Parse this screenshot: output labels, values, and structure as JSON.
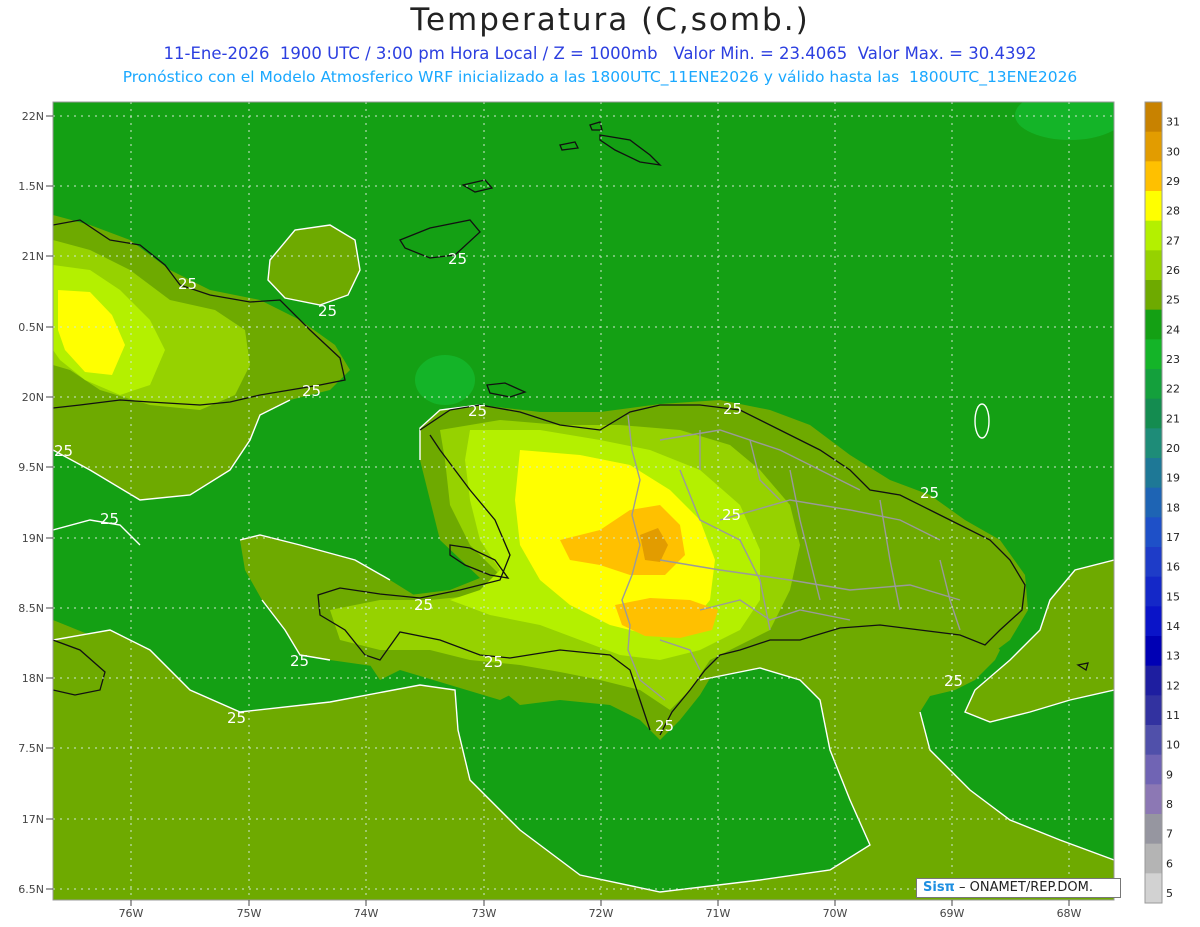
{
  "header": {
    "title": "Temperatura (C,somb.)",
    "subtitle1": "11-Ene-2026  1900 UTC / 3:00 pm Hora Local / Z = 1000mb   Valor Min. = 23.4065  Valor Max. = 30.4392",
    "subtitle2": "Pronóstico con el Modelo Atmosferico WRF inicializado a las 1800UTC_11ENE2026 y válido hasta las  1800UTC_13ENE2026"
  },
  "axes": {
    "lon_labels": [
      "76W",
      "75W",
      "74W",
      "73W",
      "72W",
      "71W",
      "70W",
      "69W",
      "68W"
    ],
    "lat_labels": [
      "22N",
      "1.5N",
      "21N",
      "0.5N",
      "20N",
      "9.5N",
      "19N",
      "8.5N",
      "18N",
      "7.5N",
      "17N",
      "6.5N"
    ]
  },
  "contours": {
    "labels": [
      "25",
      "25",
      "25",
      "25",
      "25",
      "25",
      "25",
      "25",
      "25",
      "25",
      "25",
      "25",
      "25",
      "25",
      "25",
      "25"
    ]
  },
  "colorbar": {
    "labels": [
      "31",
      "30",
      "29",
      "28",
      "27",
      "26",
      "25",
      "24",
      "23",
      "22",
      "21",
      "20",
      "19",
      "18",
      "17",
      "16",
      "15",
      "14",
      "13",
      "12",
      "11",
      "10",
      "9",
      "8",
      "7",
      "6",
      "5"
    ],
    "colors": [
      "#c88200",
      "#e29c00",
      "#ffc000",
      "#ffff00",
      "#b4f000",
      "#96d200",
      "#6eaa00",
      "#14a014",
      "#14b428",
      "#14a03c",
      "#148c50",
      "#1e8c78",
      "#1e7896",
      "#1e64b4",
      "#1e50c8",
      "#1e3cc8",
      "#1428c8",
      "#0a14c8",
      "#0000b4",
      "#1e1ea0",
      "#3232a0",
      "#5050aa",
      "#7064b4",
      "#8c78b4",
      "#9696a0",
      "#b4b4b4",
      "#d2d2d2"
    ]
  },
  "colors": {
    "land_low": "#6eaa00",
    "land_mid": "#96d200",
    "land_warm": "#b4f000",
    "land_hot": "#ffff00",
    "land_hotter": "#ffc000",
    "land_hottest": "#e29c00",
    "sea_24": "#14a014",
    "sea_25": "#6eaa00"
  },
  "credit": {
    "logo": "Sisπ",
    "text": "– ONAMET/REP.DOM."
  }
}
